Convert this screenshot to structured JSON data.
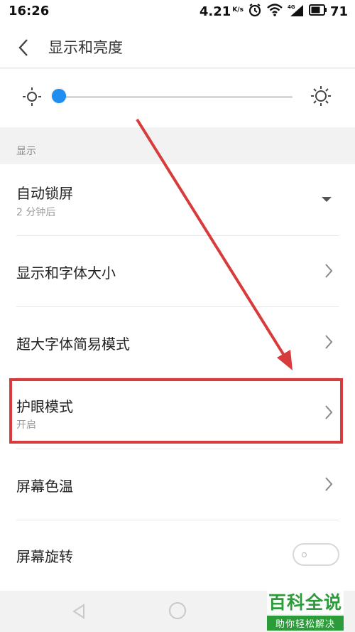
{
  "status_bar": {
    "time": "16:26",
    "net_speed": "4.21",
    "net_unit": "K/s",
    "battery": "71",
    "icons": [
      "alarm-icon",
      "wifi-icon",
      "4g-signal-icon",
      "battery-icon"
    ]
  },
  "header": {
    "title": "显示和亮度",
    "back_icon": "chevron-left-icon"
  },
  "brightness": {
    "level": 0.0,
    "icon_low": "sun-small-icon",
    "icon_high": "sun-large-icon",
    "accent": "#1e8ff0"
  },
  "section": {
    "label": "显示"
  },
  "items": [
    {
      "title": "自动锁屏",
      "subtitle": "2 分钟后",
      "control": "dropdown"
    },
    {
      "title": "显示和字体大小",
      "subtitle": "",
      "control": "chevron"
    },
    {
      "title": "超大字体简易模式",
      "subtitle": "",
      "control": "chevron"
    },
    {
      "title": "护眼模式",
      "subtitle": "开启",
      "control": "chevron"
    },
    {
      "title": "屏幕色温",
      "subtitle": "",
      "control": "chevron"
    },
    {
      "title": "屏幕旋转",
      "subtitle": "",
      "control": "toggle",
      "toggle_on": false
    }
  ],
  "annotation": {
    "color": "#d83b3b"
  },
  "watermark": {
    "main": "百科全说",
    "sub": "助你轻松解决"
  }
}
